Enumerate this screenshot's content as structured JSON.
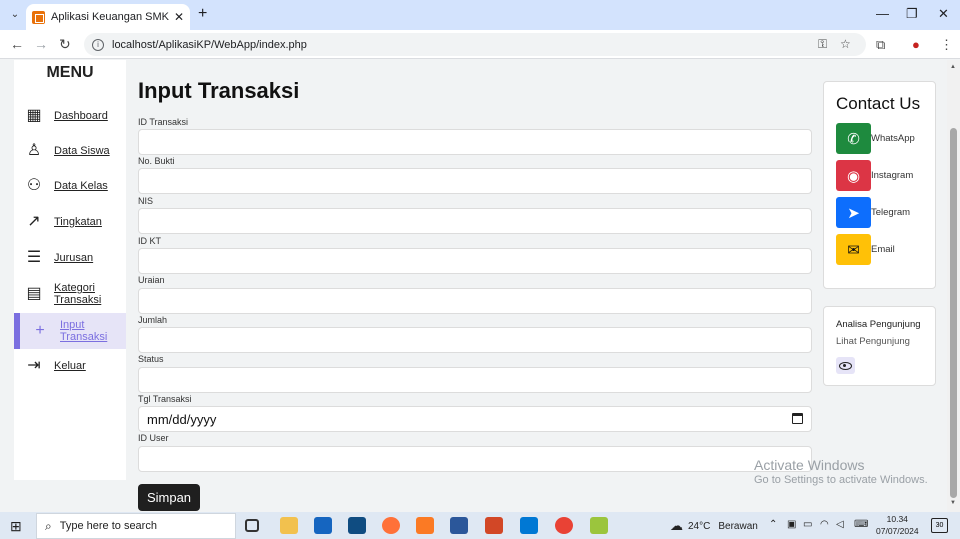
{
  "browser": {
    "tab_title": "Aplikasi Keuangan SMK Padindi",
    "url": "localhost/AplikasiKP/WebApp/index.php"
  },
  "sidebar": {
    "title": "MENU",
    "items": [
      {
        "label": "Dashboard",
        "icon": "grid-icon"
      },
      {
        "label": "Data Siswa",
        "icon": "user-icon"
      },
      {
        "label": "Data Kelas",
        "icon": "users-icon"
      },
      {
        "label": "Tingkatan",
        "icon": "trend-icon"
      },
      {
        "label": "Jurusan",
        "icon": "list-user-icon"
      },
      {
        "label": "Kategori Transaksi",
        "icon": "document-icon"
      },
      {
        "label": "Input Transaksi",
        "icon": "plus-icon",
        "active": true
      },
      {
        "label": "Keluar",
        "icon": "logout-icon"
      }
    ]
  },
  "main": {
    "title": "Input Transaksi",
    "fields": [
      {
        "label": "ID Transaksi",
        "value": ""
      },
      {
        "label": "No. Bukti",
        "value": ""
      },
      {
        "label": "NIS",
        "value": ""
      },
      {
        "label": "ID KT",
        "value": ""
      },
      {
        "label": "Uraian",
        "value": ""
      },
      {
        "label": "Jumlah",
        "value": ""
      },
      {
        "label": "Status",
        "value": ""
      },
      {
        "label": "Tgl Transaksi",
        "value": "mm/dd/yyyy"
      },
      {
        "label": "ID User",
        "value": ""
      }
    ],
    "submit_label": "Simpan"
  },
  "contact": {
    "title": "Contact Us",
    "items": [
      {
        "label": "WhatsApp",
        "color": "#1e8a3e"
      },
      {
        "label": "Instagram",
        "color": "#dc3545"
      },
      {
        "label": "Telegram",
        "color": "#0d6efd"
      },
      {
        "label": "Email",
        "color": "#ffc107"
      }
    ]
  },
  "analisa": {
    "title": "Analisa Pengunjung",
    "link": "Lihat Pengunjung"
  },
  "watermark": {
    "line1": "Activate Windows",
    "line2": "Go to Settings to activate Windows."
  },
  "taskbar": {
    "search_placeholder": "Type here to search",
    "temperature": "24°C",
    "weather": "Berawan",
    "time": "10.34",
    "date": "07/07/2024",
    "notifications": "30"
  }
}
